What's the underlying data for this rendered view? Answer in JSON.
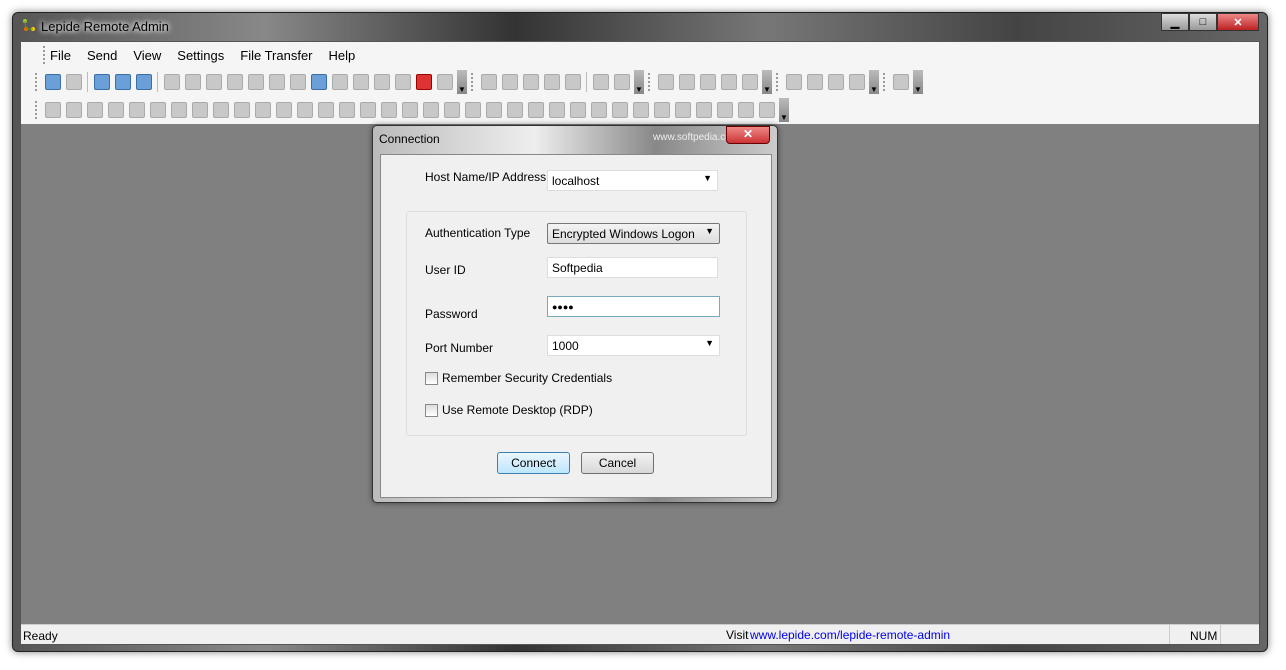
{
  "window": {
    "title": "Lepide Remote Admin",
    "minimize": "▁",
    "maximize": "□",
    "close": "✕"
  },
  "menu": [
    "File",
    "Send",
    "View",
    "Settings",
    "File Transfer",
    "Help"
  ],
  "toolbar1": [
    [
      "connect",
      "disconnect"
    ],
    [
      "add-computer",
      "schedule",
      "remove-computer"
    ],
    [
      "window",
      "print",
      "search",
      "monitor",
      "network",
      "refresh",
      "blank-window",
      "scheduler",
      "lock",
      "share",
      "frame",
      "copy",
      "close-connection",
      "users"
    ],
    [
      "console",
      "zoom",
      "screen",
      "transfer",
      "settings"
    ],
    [
      "volume",
      "equalizer"
    ],
    [
      "handshake",
      "document",
      "cable",
      "process",
      "report"
    ],
    [
      "server",
      "calculator",
      "lock-pc",
      "power"
    ],
    [
      "cascade"
    ]
  ],
  "toolbar2": [
    "log",
    "windows",
    "tasks",
    "task-user",
    "grid",
    "services",
    "edit",
    "window2",
    "window-network",
    "disk",
    "cdrom",
    "gear",
    "globe",
    "globe-add",
    "search-pc",
    "book",
    "window3",
    "layout",
    "folder",
    "refresh-pc",
    "monitor-down",
    "pc-remove",
    "pc-remove2",
    "pc-x",
    "window-remove",
    "window4",
    "window5",
    "user-pc",
    "users-pc",
    "pc-gear",
    "gears",
    "network-user",
    "user-group",
    "pc-refresh",
    "pc-copy"
  ],
  "dialog": {
    "title": "Connection",
    "close": "✕",
    "watermark": "www.softpedia.com",
    "host_label": "Host Name/IP Address",
    "host_value": "localhost",
    "auth_label": "Authentication Type",
    "auth_value": "Encrypted Windows Logon",
    "user_label": "User ID",
    "user_value": "Softpedia",
    "password_label": "Password",
    "password_value": "●●●●",
    "port_label": "Port Number",
    "port_value": "1000",
    "remember_label": "Remember Security Credentials",
    "rdp_label": "Use Remote Desktop (RDP)",
    "remember_checked": false,
    "rdp_checked": false,
    "connect": "Connect",
    "cancel": "Cancel"
  },
  "status": {
    "text": "Ready",
    "visit": "Visit",
    "link": "www.lepide.com/lepide-remote-admin",
    "num": "NUM"
  },
  "colors": {
    "link": "#0000ee",
    "workspace": "#808080"
  }
}
